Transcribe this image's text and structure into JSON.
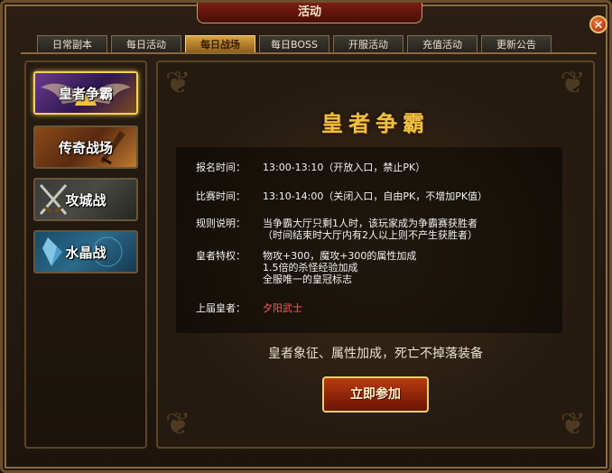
{
  "window": {
    "title": "活动",
    "close_icon": "close-icon"
  },
  "tabs": [
    {
      "label": "日常副本",
      "active": false
    },
    {
      "label": "每日活动",
      "active": false
    },
    {
      "label": "每日战场",
      "active": true
    },
    {
      "label": "每日BOSS",
      "active": false
    },
    {
      "label": "开服活动",
      "active": false
    },
    {
      "label": "充值活动",
      "active": false
    },
    {
      "label": "更新公告",
      "active": false
    }
  ],
  "sidebar": {
    "items": [
      {
        "label": "皇者争霸",
        "selected": true
      },
      {
        "label": "传奇战场",
        "selected": false
      },
      {
        "label": "攻城战",
        "selected": false
      },
      {
        "label": "水晶战",
        "selected": false
      }
    ]
  },
  "main": {
    "title": "皇者争霸",
    "info": {
      "signup": {
        "label": "报名时间：",
        "value": "13:00-13:10（开放入口，禁止PK）"
      },
      "match": {
        "label": "比赛时间：",
        "value": "13:10-14:00（关闭入口，自由PK，不增加PK值）"
      },
      "rules": {
        "label": "规则说明：",
        "line1": "当争霸大厅只剩1人时，该玩家成为争霸赛获胜者",
        "line2": "（时间结束时大厅内有2人以上则不产生获胜者）"
      },
      "privileges": {
        "label": "皇者特权：",
        "line1": "物攻+300，魔攻+300的属性加成",
        "line2": "1.5倍的杀怪经验加成",
        "line3": "全服唯一的皇冠标志"
      },
      "previous": {
        "label": "上届皇者：",
        "value": "夕阳武士"
      }
    },
    "slogan": "皇者象征、属性加成，死亡不掉落装备",
    "join_button": "立即参加"
  },
  "colors": {
    "accent": "#f0c040",
    "highlight_red": "#ff5a5a",
    "active_tab": "#d8a440"
  }
}
